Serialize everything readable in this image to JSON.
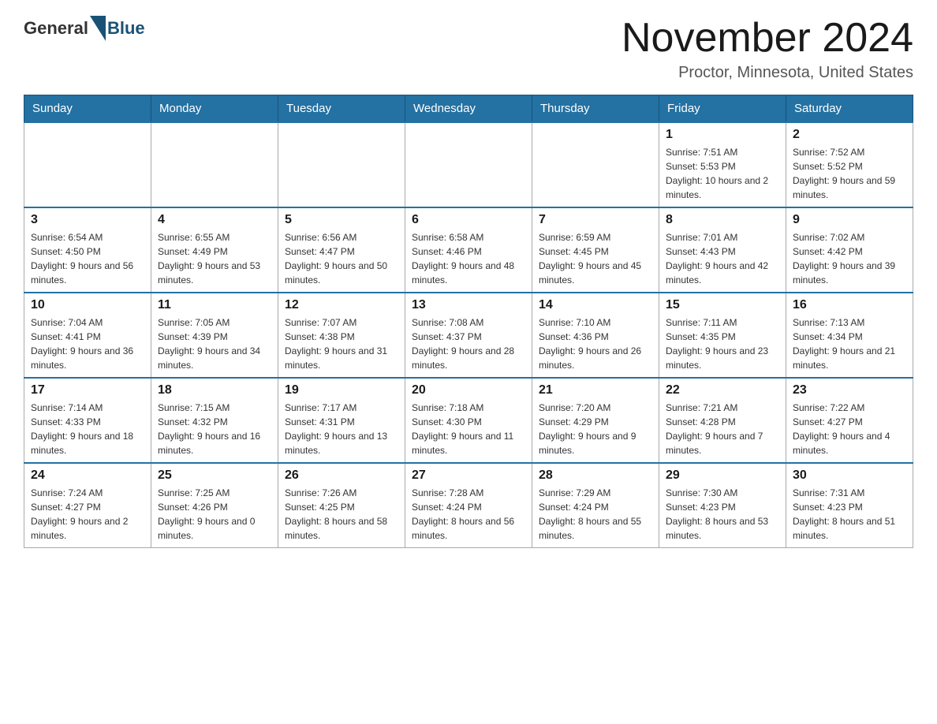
{
  "header": {
    "logo_general": "General",
    "logo_blue": "Blue",
    "main_title": "November 2024",
    "subtitle": "Proctor, Minnesota, United States"
  },
  "weekdays": [
    "Sunday",
    "Monday",
    "Tuesday",
    "Wednesday",
    "Thursday",
    "Friday",
    "Saturday"
  ],
  "weeks": [
    {
      "days": [
        {
          "empty": true
        },
        {
          "empty": true
        },
        {
          "empty": true
        },
        {
          "empty": true
        },
        {
          "empty": true
        },
        {
          "number": "1",
          "sunrise": "7:51 AM",
          "sunset": "5:53 PM",
          "daylight": "10 hours and 2 minutes."
        },
        {
          "number": "2",
          "sunrise": "7:52 AM",
          "sunset": "5:52 PM",
          "daylight": "9 hours and 59 minutes."
        }
      ]
    },
    {
      "days": [
        {
          "number": "3",
          "sunrise": "6:54 AM",
          "sunset": "4:50 PM",
          "daylight": "9 hours and 56 minutes."
        },
        {
          "number": "4",
          "sunrise": "6:55 AM",
          "sunset": "4:49 PM",
          "daylight": "9 hours and 53 minutes."
        },
        {
          "number": "5",
          "sunrise": "6:56 AM",
          "sunset": "4:47 PM",
          "daylight": "9 hours and 50 minutes."
        },
        {
          "number": "6",
          "sunrise": "6:58 AM",
          "sunset": "4:46 PM",
          "daylight": "9 hours and 48 minutes."
        },
        {
          "number": "7",
          "sunrise": "6:59 AM",
          "sunset": "4:45 PM",
          "daylight": "9 hours and 45 minutes."
        },
        {
          "number": "8",
          "sunrise": "7:01 AM",
          "sunset": "4:43 PM",
          "daylight": "9 hours and 42 minutes."
        },
        {
          "number": "9",
          "sunrise": "7:02 AM",
          "sunset": "4:42 PM",
          "daylight": "9 hours and 39 minutes."
        }
      ]
    },
    {
      "days": [
        {
          "number": "10",
          "sunrise": "7:04 AM",
          "sunset": "4:41 PM",
          "daylight": "9 hours and 36 minutes."
        },
        {
          "number": "11",
          "sunrise": "7:05 AM",
          "sunset": "4:39 PM",
          "daylight": "9 hours and 34 minutes."
        },
        {
          "number": "12",
          "sunrise": "7:07 AM",
          "sunset": "4:38 PM",
          "daylight": "9 hours and 31 minutes."
        },
        {
          "number": "13",
          "sunrise": "7:08 AM",
          "sunset": "4:37 PM",
          "daylight": "9 hours and 28 minutes."
        },
        {
          "number": "14",
          "sunrise": "7:10 AM",
          "sunset": "4:36 PM",
          "daylight": "9 hours and 26 minutes."
        },
        {
          "number": "15",
          "sunrise": "7:11 AM",
          "sunset": "4:35 PM",
          "daylight": "9 hours and 23 minutes."
        },
        {
          "number": "16",
          "sunrise": "7:13 AM",
          "sunset": "4:34 PM",
          "daylight": "9 hours and 21 minutes."
        }
      ]
    },
    {
      "days": [
        {
          "number": "17",
          "sunrise": "7:14 AM",
          "sunset": "4:33 PM",
          "daylight": "9 hours and 18 minutes."
        },
        {
          "number": "18",
          "sunrise": "7:15 AM",
          "sunset": "4:32 PM",
          "daylight": "9 hours and 16 minutes."
        },
        {
          "number": "19",
          "sunrise": "7:17 AM",
          "sunset": "4:31 PM",
          "daylight": "9 hours and 13 minutes."
        },
        {
          "number": "20",
          "sunrise": "7:18 AM",
          "sunset": "4:30 PM",
          "daylight": "9 hours and 11 minutes."
        },
        {
          "number": "21",
          "sunrise": "7:20 AM",
          "sunset": "4:29 PM",
          "daylight": "9 hours and 9 minutes."
        },
        {
          "number": "22",
          "sunrise": "7:21 AM",
          "sunset": "4:28 PM",
          "daylight": "9 hours and 7 minutes."
        },
        {
          "number": "23",
          "sunrise": "7:22 AM",
          "sunset": "4:27 PM",
          "daylight": "9 hours and 4 minutes."
        }
      ]
    },
    {
      "days": [
        {
          "number": "24",
          "sunrise": "7:24 AM",
          "sunset": "4:27 PM",
          "daylight": "9 hours and 2 minutes."
        },
        {
          "number": "25",
          "sunrise": "7:25 AM",
          "sunset": "4:26 PM",
          "daylight": "9 hours and 0 minutes."
        },
        {
          "number": "26",
          "sunrise": "7:26 AM",
          "sunset": "4:25 PM",
          "daylight": "8 hours and 58 minutes."
        },
        {
          "number": "27",
          "sunrise": "7:28 AM",
          "sunset": "4:24 PM",
          "daylight": "8 hours and 56 minutes."
        },
        {
          "number": "28",
          "sunrise": "7:29 AM",
          "sunset": "4:24 PM",
          "daylight": "8 hours and 55 minutes."
        },
        {
          "number": "29",
          "sunrise": "7:30 AM",
          "sunset": "4:23 PM",
          "daylight": "8 hours and 53 minutes."
        },
        {
          "number": "30",
          "sunrise": "7:31 AM",
          "sunset": "4:23 PM",
          "daylight": "8 hours and 51 minutes."
        }
      ]
    }
  ],
  "labels": {
    "sunrise": "Sunrise:",
    "sunset": "Sunset:",
    "daylight": "Daylight:"
  }
}
